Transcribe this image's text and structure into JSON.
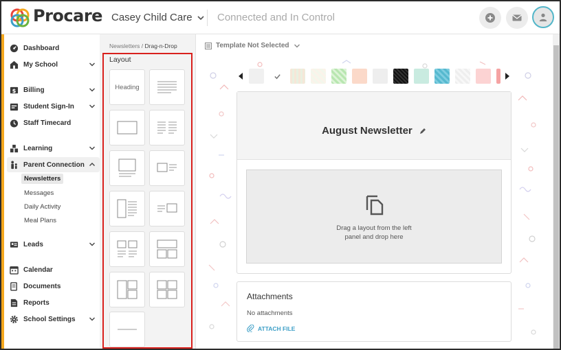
{
  "header": {
    "brand": "Procare",
    "school": "Casey Child Care",
    "tagline": "Connected and In Control"
  },
  "sidebar": {
    "items": [
      {
        "label": "Dashboard",
        "icon": "dashboard-icon"
      },
      {
        "label": "My School",
        "icon": "school-icon"
      },
      {
        "label": "Billing",
        "icon": "billing-icon"
      },
      {
        "label": "Student Sign-In",
        "icon": "sign-in-icon"
      },
      {
        "label": "Staff Timecard",
        "icon": "timecard-icon"
      },
      {
        "label": "Learning",
        "icon": "learning-icon"
      },
      {
        "label": "Parent Connection",
        "icon": "parent-icon"
      },
      {
        "label": "Leads",
        "icon": "leads-icon"
      },
      {
        "label": "Calendar",
        "icon": "calendar-icon"
      },
      {
        "label": "Documents",
        "icon": "documents-icon"
      },
      {
        "label": "Reports",
        "icon": "reports-icon"
      },
      {
        "label": "School Settings",
        "icon": "gear-icon"
      }
    ],
    "sub_items": [
      "Newsletters",
      "Messages",
      "Daily Activity",
      "Meal Plans"
    ]
  },
  "panel": {
    "crumb_parent": "Newsletters",
    "crumb_sep": " / ",
    "crumb_current": "Drag-n-Drop",
    "title": "Layout",
    "heading_tile": "Heading"
  },
  "main": {
    "template_label": "Template Not Selected",
    "newsletter_title": "August Newsletter",
    "dropzone_line1": "Drag a layout from the left",
    "dropzone_line2": "panel and drop here",
    "attachments_title": "Attachments",
    "attachments_empty": "No attachments",
    "attach_button": "ATTACH FILE"
  },
  "colors": {
    "accent": "#f4a71d",
    "highlight": "#d9201c",
    "link": "#3d9fc7"
  }
}
